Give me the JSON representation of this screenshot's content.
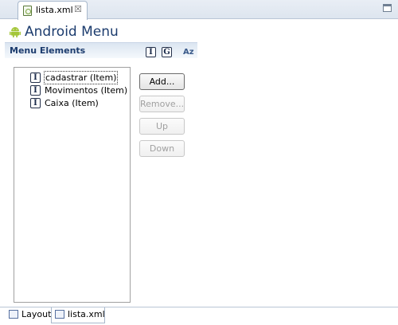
{
  "editor_tab": {
    "label": "lista.xml",
    "close_glyph": "☒"
  },
  "header": {
    "title": "Android Menu",
    "icon": "android-icon"
  },
  "section": {
    "title": "Menu Elements",
    "sort_buttons": [
      {
        "glyph": "I"
      },
      {
        "glyph": "G"
      }
    ],
    "az_label": "Az"
  },
  "tree": {
    "item_icon_glyph": "I",
    "items": [
      {
        "label": "cadastrar (Item)",
        "selected": true
      },
      {
        "label": "Movimentos (Item)",
        "selected": false
      },
      {
        "label": "Caixa (Item)",
        "selected": false
      }
    ]
  },
  "buttons": {
    "add": "Add...",
    "remove": "Remove...",
    "up": "Up",
    "down": "Down"
  },
  "bottom_tabs": [
    {
      "label": "Layout",
      "active": false
    },
    {
      "label": "lista.xml",
      "active": true
    }
  ],
  "colors": {
    "title": "#1c3c6e",
    "android_green": "#a4c639",
    "disabled_text": "#a0a0a0"
  }
}
